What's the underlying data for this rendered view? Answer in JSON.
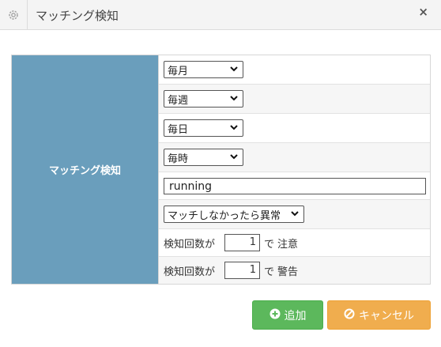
{
  "dialog": {
    "title": "マッチング検知",
    "title_icon": "gear-icon",
    "close_label": "×"
  },
  "form": {
    "section_label": "マッチング検知",
    "month_select": "毎月",
    "week_select": "毎週",
    "day_select": "毎日",
    "hour_select": "毎時",
    "pattern_value": "running",
    "condition_select": "マッチしなかったら異常",
    "caution": {
      "prefix": "検知回数が",
      "count": "1",
      "connector": "で",
      "level": "注意"
    },
    "warning": {
      "prefix": "検知回数が",
      "count": "1",
      "connector": "で",
      "level": "警告"
    }
  },
  "buttons": {
    "add_icon": "plus-circle-icon",
    "add_label": "追加",
    "cancel_icon": "ban-icon",
    "cancel_label": "キャンセル"
  },
  "colors": {
    "label_bg": "#6a9ebc",
    "add_button": "#5cb85c",
    "cancel_button": "#f0ad4e"
  }
}
